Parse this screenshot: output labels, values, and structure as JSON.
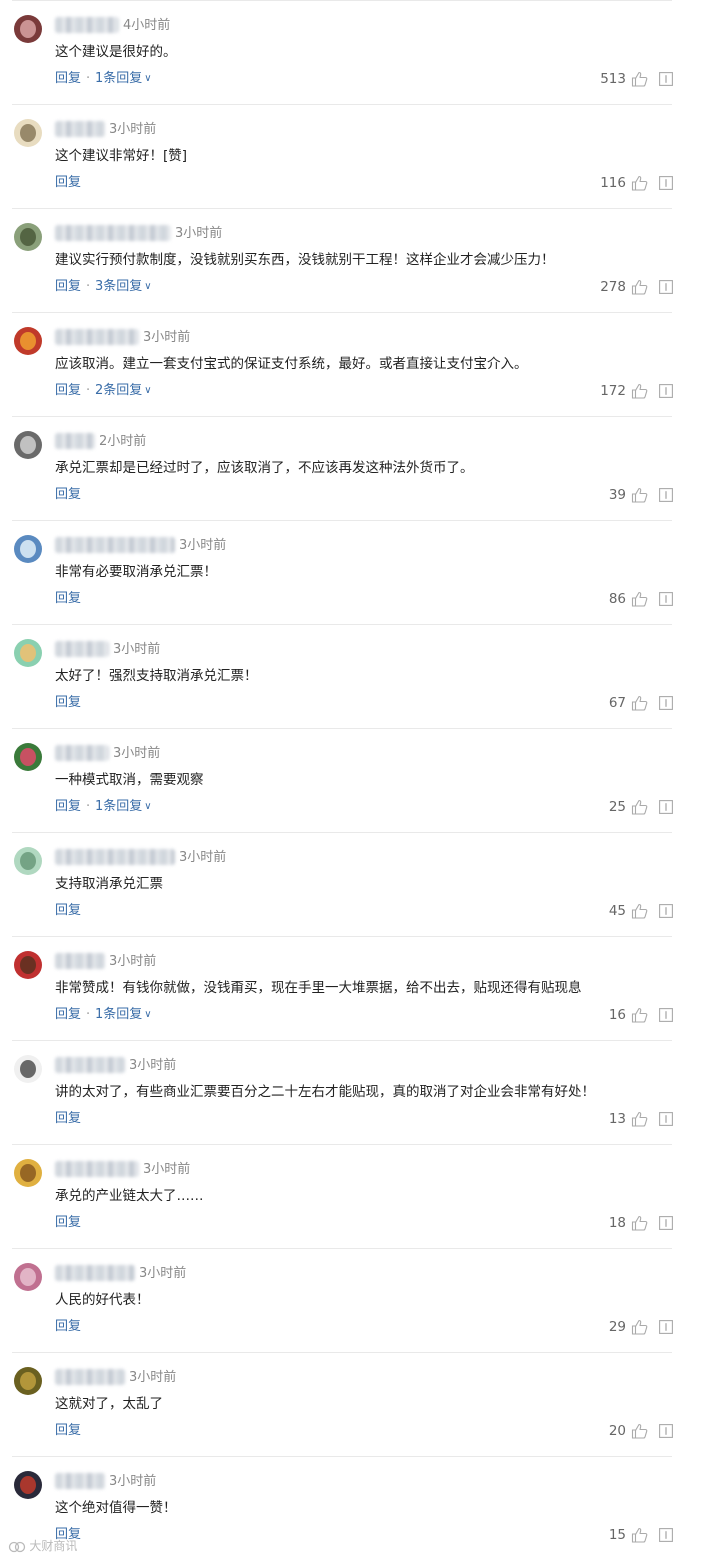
{
  "ui": {
    "reply_label": "回复",
    "reply_count_suffix": "回复",
    "separator": "·",
    "accent_color": "#3a6da8"
  },
  "comments": [
    {
      "time": "4小时前",
      "text": "这个建议是很好的。",
      "reply_count": "1条",
      "likes": "513",
      "avatar_colors": [
        "#7a3a3a",
        "#d9a3a3"
      ]
    },
    {
      "time": "3小时前",
      "text": "这个建议非常好！[赞]",
      "reply_count": "",
      "likes": "116",
      "avatar_colors": [
        "#e8dcc0",
        "#8a7a5a"
      ]
    },
    {
      "time": "3小时前",
      "text": "建议实行预付款制度，没钱就别买东西，没钱就别干工程！这样企业才会减少压力！",
      "reply_count": "3条",
      "likes": "278",
      "avatar_colors": [
        "#8aa07a",
        "#4a5a3a"
      ]
    },
    {
      "time": "3小时前",
      "text": "应该取消。建立一套支付宝式的保证支付系统，最好。或者直接让支付宝介入。",
      "reply_count": "2条",
      "likes": "172",
      "avatar_colors": [
        "#c03a2a",
        "#f0a030"
      ]
    },
    {
      "time": "2小时前",
      "text": "承兑汇票却是已经过时了，应该取消了，不应该再发这种法外货币了。",
      "reply_count": "",
      "likes": "39",
      "avatar_colors": [
        "#6a6a6a",
        "#d0d0d0"
      ]
    },
    {
      "time": "3小时前",
      "text": "非常有必要取消承兑汇票！",
      "reply_count": "",
      "likes": "86",
      "avatar_colors": [
        "#5a8ac0",
        "#e0eef8"
      ]
    },
    {
      "time": "3小时前",
      "text": "太好了！强烈支持取消承兑汇票！",
      "reply_count": "",
      "likes": "67",
      "avatar_colors": [
        "#8ad0b0",
        "#f0c070"
      ]
    },
    {
      "time": "3小时前",
      "text": "一种模式取消，需要观察",
      "reply_count": "1条",
      "likes": "25",
      "avatar_colors": [
        "#3a7a3a",
        "#e04a6a"
      ]
    },
    {
      "time": "3小时前",
      "text": "支持取消承兑汇票",
      "reply_count": "",
      "likes": "45",
      "avatar_colors": [
        "#b0d8c0",
        "#6a9a7a"
      ]
    },
    {
      "time": "3小时前",
      "text": "非常赞成！有钱你就做，没钱甭买，现在手里一大堆票据，给不出去，贴现还得有贴现息",
      "reply_count": "1条",
      "likes": "16",
      "avatar_colors": [
        "#c03030",
        "#5a3020"
      ]
    },
    {
      "time": "3小时前",
      "text": "讲的太对了，有些商业汇票要百分之二十左右才能贴现，真的取消了对企业会非常有好处！",
      "reply_count": "",
      "likes": "13",
      "avatar_colors": [
        "#f0f0f0",
        "#505050"
      ]
    },
    {
      "time": "3小时前",
      "text": "承兑的产业链太大了……",
      "reply_count": "",
      "likes": "18",
      "avatar_colors": [
        "#e0b040",
        "#8a5a20"
      ]
    },
    {
      "time": "3小时前",
      "text": "人民的好代表！",
      "reply_count": "",
      "likes": "29",
      "avatar_colors": [
        "#c07090",
        "#e8c0d0"
      ]
    },
    {
      "time": "3小时前",
      "text": "这就对了，太乱了",
      "reply_count": "",
      "likes": "20",
      "avatar_colors": [
        "#6a6020",
        "#c0a040"
      ]
    },
    {
      "time": "3小时前",
      "text": "这个绝对值得一赞！",
      "reply_count": "",
      "likes": "15",
      "avatar_colors": [
        "#2a2a3a",
        "#c0392b"
      ]
    }
  ],
  "watermark": "大财商讯"
}
